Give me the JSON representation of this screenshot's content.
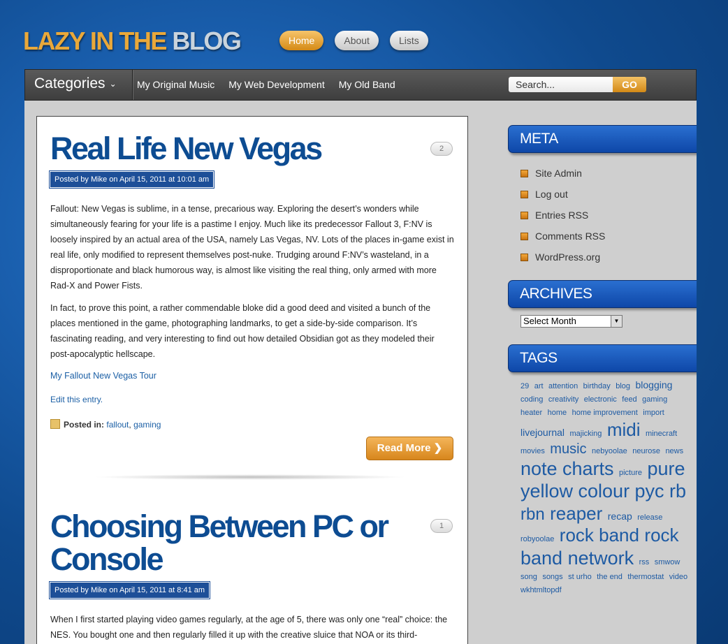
{
  "site": {
    "title_part1": "LAZY IN THE",
    "title_part2": "BLOG"
  },
  "topnav": [
    {
      "label": "Home",
      "active": true
    },
    {
      "label": "About",
      "active": false
    },
    {
      "label": "Lists",
      "active": false
    }
  ],
  "navbar": {
    "categories_label": "Categories",
    "links": [
      "My Original Music",
      "My Web Development",
      "My Old Band"
    ],
    "search_value": "Search...",
    "go_label": "GO"
  },
  "posts": [
    {
      "title": "Real Life New Vegas",
      "comments": "2",
      "meta": "Posted by Mike on April 15, 2011 at 10:01 am",
      "paragraphs": [
        "Fallout: New Vegas is sublime, in a tense, precarious way. Exploring the desert’s wonders while simultaneously fearing for your life is a pastime I enjoy. Much like its predecessor Fallout 3, F:NV is loosely inspired by an actual area of the USA, namely Las Vegas, NV. Lots of the places in-game exist in real life, only modified to represent themselves post-nuke. Trudging around F:NV’s wasteland, in a disproportionate and black humorous way, is almost like visiting the real thing, only armed with more Rad-X and Power Fists.",
        "In fact, to prove this point, a rather commendable bloke did a good deed and visited a bunch of the places mentioned in the game, photographing landmarks, to get a side-by-side comparison. It’s fascinating reading, and very interesting to find out how detailed Obsidian got as they modeled their post-apocalyptic hellscape."
      ],
      "link": "My Fallout New Vegas Tour",
      "edit": "Edit this entry.",
      "posted_in_label": "Posted in:",
      "tags": [
        "fallout",
        "gaming"
      ],
      "read_more": "Read More"
    },
    {
      "title": "Choosing Between PC or Console",
      "comments": "1",
      "meta": "Posted by Mike on April 15, 2011 at 8:41 am",
      "paragraphs": [
        "When I first started playing video games regularly, at the age of 5, there was only one “real” choice: the NES. You bought one and then regularly filled it up with the creative sluice that NOA or its third-"
      ]
    }
  ],
  "sidebar": {
    "meta_title": "META",
    "meta_links": [
      "Site Admin",
      "Log out",
      "Entries RSS",
      "Comments RSS",
      "WordPress.org"
    ],
    "archives_title": "ARCHIVES",
    "archives_select": "Select Month",
    "tags_title": "TAGS",
    "tags": [
      {
        "t": "29",
        "s": 11
      },
      {
        "t": "art",
        "s": 11
      },
      {
        "t": "attention",
        "s": 11
      },
      {
        "t": "birthday",
        "s": 11
      },
      {
        "t": "blog",
        "s": 11
      },
      {
        "t": "blogging",
        "s": 14
      },
      {
        "t": "coding",
        "s": 11
      },
      {
        "t": "creativity",
        "s": 11
      },
      {
        "t": "electronic",
        "s": 11
      },
      {
        "t": "feed",
        "s": 11
      },
      {
        "t": "gaming",
        "s": 11
      },
      {
        "t": "heater",
        "s": 11
      },
      {
        "t": "home",
        "s": 11
      },
      {
        "t": "home improvement",
        "s": 11
      },
      {
        "t": "import",
        "s": 11
      },
      {
        "t": "livejournal",
        "s": 14
      },
      {
        "t": "majicking",
        "s": 11
      },
      {
        "t": "midi",
        "s": 26
      },
      {
        "t": "minecraft",
        "s": 11
      },
      {
        "t": "movies",
        "s": 11
      },
      {
        "t": "music",
        "s": 20
      },
      {
        "t": "nebyoolae",
        "s": 11
      },
      {
        "t": "neurose",
        "s": 11
      },
      {
        "t": "news",
        "s": 11
      },
      {
        "t": "note",
        "s": 27
      },
      {
        "t": "charts",
        "s": 27
      },
      {
        "t": "picture",
        "s": 11
      },
      {
        "t": "pure",
        "s": 27
      },
      {
        "t": "yellow colour",
        "s": 27
      },
      {
        "t": "pyc",
        "s": 27
      },
      {
        "t": "rb",
        "s": 27
      },
      {
        "t": "rbn",
        "s": 24
      },
      {
        "t": "reaper",
        "s": 26
      },
      {
        "t": "recap",
        "s": 14
      },
      {
        "t": "release",
        "s": 11
      },
      {
        "t": "robyoolae",
        "s": 11
      },
      {
        "t": "rock band",
        "s": 26
      },
      {
        "t": "rock",
        "s": 26
      },
      {
        "t": "band network",
        "s": 27
      },
      {
        "t": "rss",
        "s": 11
      },
      {
        "t": "smwow",
        "s": 11
      },
      {
        "t": "song",
        "s": 11
      },
      {
        "t": "songs",
        "s": 11
      },
      {
        "t": "st urho",
        "s": 11
      },
      {
        "t": "the end",
        "s": 11
      },
      {
        "t": "thermostat",
        "s": 11
      },
      {
        "t": "video",
        "s": 11
      },
      {
        "t": "wkhtmltopdf",
        "s": 11
      }
    ]
  }
}
